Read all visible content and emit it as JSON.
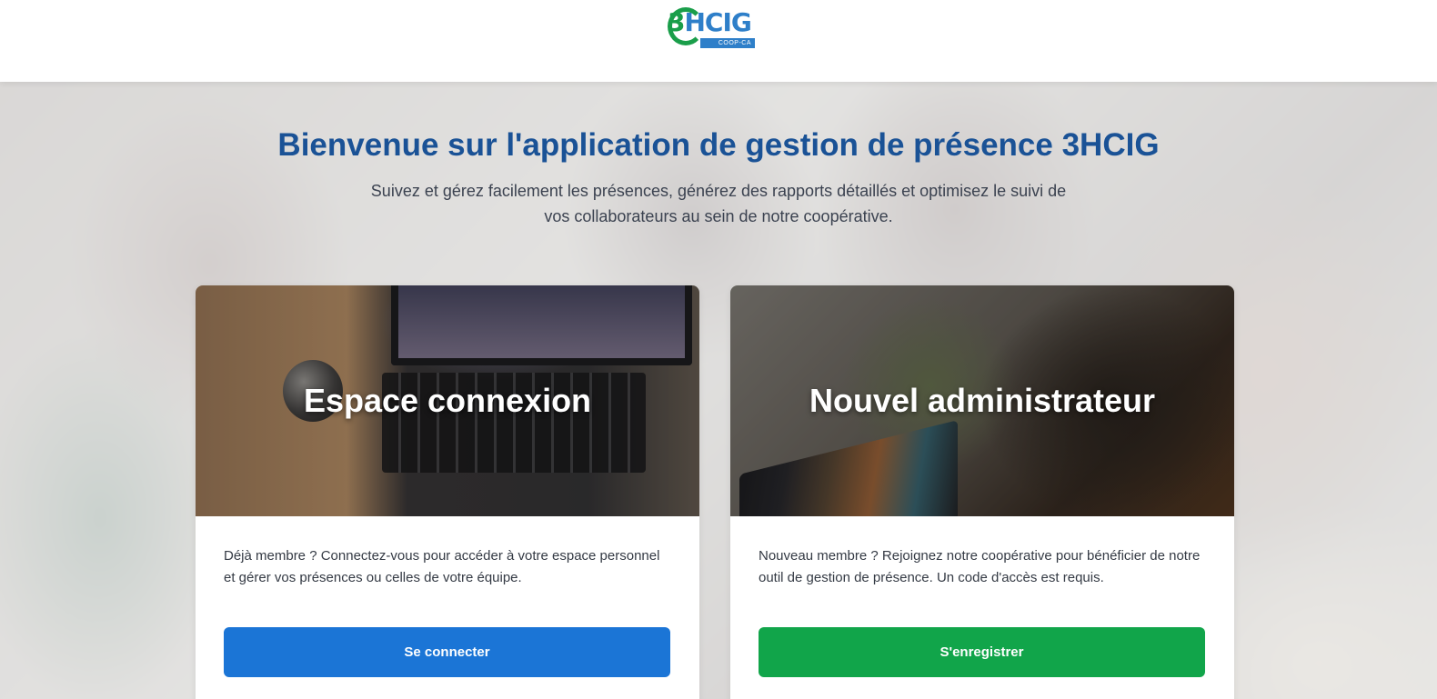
{
  "header": {
    "logo": {
      "text_3": "3",
      "text_main": "HCIG",
      "subtext": "COOP-CA",
      "colors": {
        "green": "#1a9e4a",
        "blue": "#2e7fc9"
      }
    }
  },
  "hero": {
    "title": "Bienvenue sur l'application de gestion de présence 3HCIG",
    "subtitle": "Suivez et gérez facilement les présences, générez des rapports détaillés et optimisez le suivi de vos collaborateurs au sein de notre coopérative."
  },
  "cards": [
    {
      "heading": "Espace connexion",
      "text": "Déjà membre ? Connectez-vous pour accéder à votre espace personnel et gérer vos présences ou celles de votre équipe.",
      "button_label": "Se connecter",
      "button_color": "#1b75d6"
    },
    {
      "heading": "Nouvel administrateur",
      "text": "Nouveau membre ? Rejoignez notre coopérative pour bénéficier de notre outil de gestion de présence. Un code d'accès est requis.",
      "button_label": "S'enregistrer",
      "button_color": "#11a54a"
    }
  ],
  "theme": {
    "title_color": "#1a5296",
    "text_color": "#343a44"
  }
}
